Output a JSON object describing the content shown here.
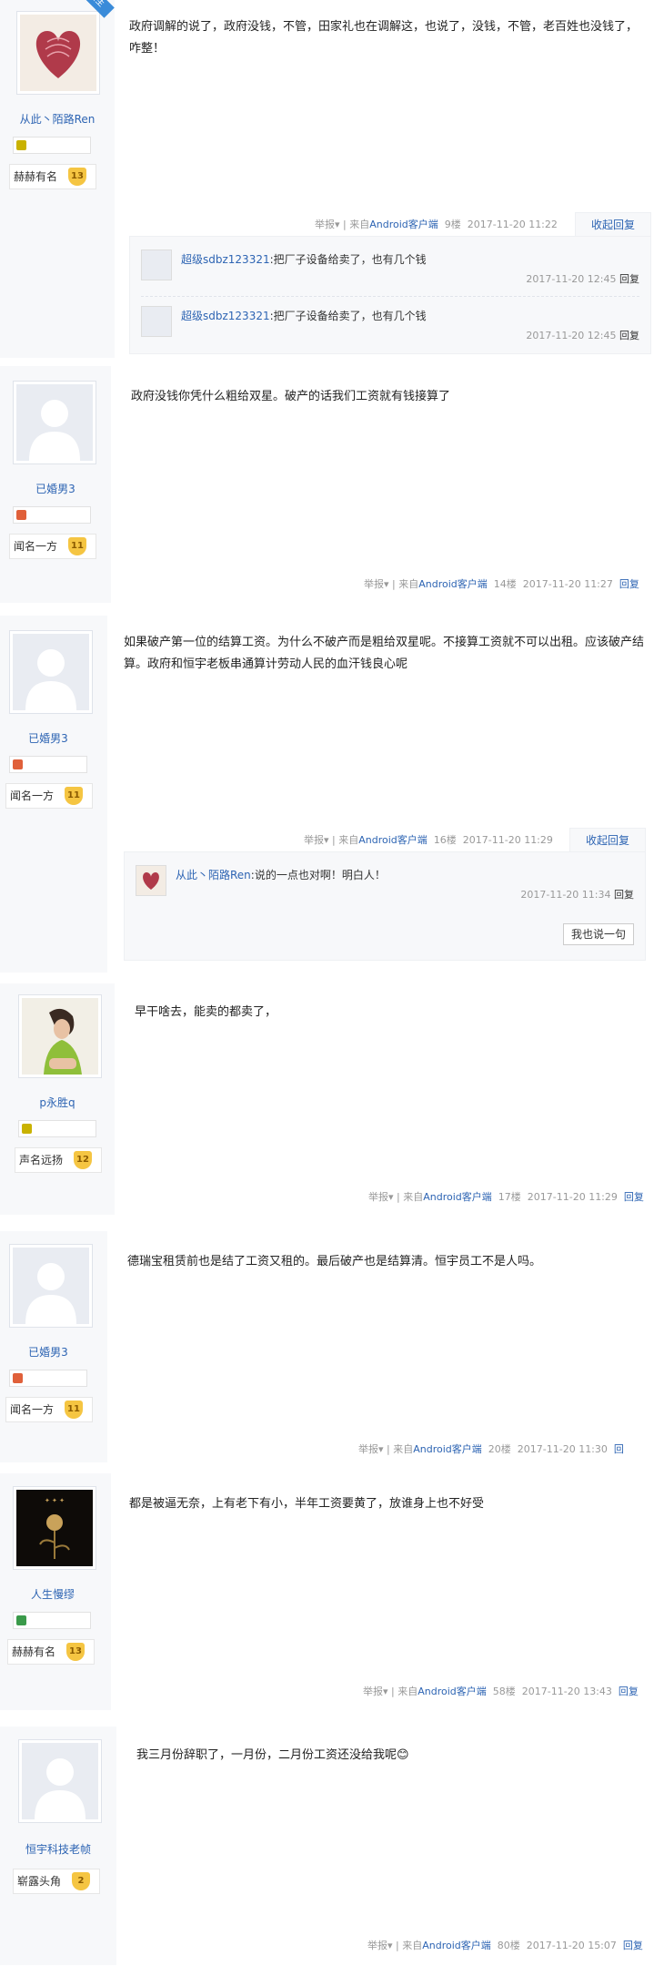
{
  "posts": [
    {
      "badge": "楼主",
      "username": "从此丶陌路Ren",
      "level_title": "赫赫有名",
      "level": "13",
      "content": "政府调解的说了，政府没钱，不管，田家礼也在调解这，也说了，没钱，不管，老百姓也没钱了，咋整！",
      "report": "举报",
      "sep": "| 来自",
      "source": "Android客户端",
      "floor": "9楼",
      "time": "2017-11-20 11:22",
      "collapse_label": "收起回复",
      "replies": [
        {
          "who": "超级sdbz123321",
          "text": ":把厂子设备给卖了，也有几个钱",
          "time": "2017-11-20 12:45",
          "reply": "回复"
        },
        {
          "who": "超级sdbz123321",
          "text": ":把厂子设备给卖了，也有几个钱",
          "time": "2017-11-20 12:45",
          "reply": "回复"
        }
      ]
    },
    {
      "username": "已婚男3",
      "level_title": "闻名一方",
      "level": "11",
      "content": "政府没钱你凭什么粗给双星。破产的话我们工资就有钱接算了",
      "report": "举报",
      "sep": "| 来自",
      "source": "Android客户端",
      "floor": "14楼",
      "time": "2017-11-20 11:27",
      "reply": "回复"
    },
    {
      "username": "已婚男3",
      "level_title": "闻名一方",
      "level": "11",
      "content": "如果破产第一位的结算工资。为什么不破产而是粗给双星呢。不接算工资就不可以出租。应该破产结算。政府和恒宇老板串通算计劳动人民的血汗钱良心呢",
      "report": "举报",
      "sep": "| 来自",
      "source": "Android客户端",
      "floor": "16楼",
      "time": "2017-11-20 11:29",
      "collapse_label": "收起回复",
      "replies": [
        {
          "who": "从此丶陌路Ren",
          "text": ":说的一点也对啊！明白人！",
          "time": "2017-11-20 11:34",
          "reply": "回复"
        }
      ],
      "say_label": "我也说一句"
    },
    {
      "username": "p永胜q",
      "level_title": "声名远扬",
      "level": "12",
      "content": "早干啥去，能卖的都卖了，",
      "report": "举报",
      "sep": "| 来自",
      "source": "Android客户端",
      "floor": "17楼",
      "time": "2017-11-20 11:29",
      "reply": "回复"
    },
    {
      "username": "已婚男3",
      "level_title": "闻名一方",
      "level": "11",
      "content": "德瑞宝租赁前也是结了工资又租的。最后破产也是结算清。恒宇员工不是人吗。",
      "report": "举报",
      "sep": "| 来自",
      "source": "Android客户端",
      "floor": "20楼",
      "time": "2017-11-20 11:30",
      "reply": "回"
    },
    {
      "username": "人生慢缪",
      "level_title": "赫赫有名",
      "level": "13",
      "content": "都是被逼无奈，上有老下有小，半年工资要黄了，放谁身上也不好受",
      "report": "举报",
      "sep": "| 来自",
      "source": "Android客户端",
      "floor": "58楼",
      "time": "2017-11-20 13:43",
      "reply": "回复"
    },
    {
      "username": "恒宇科技老帧",
      "level_title": "崭露头角",
      "level": "2",
      "content": "我三月份辞职了，一月份，二月份工资还没给我呢",
      "emoji": "😊",
      "report": "举报",
      "sep": "| 来自",
      "source": "Android客户端",
      "floor": "80楼",
      "time": "2017-11-20 15:07",
      "reply": "回复"
    }
  ],
  "colors": {
    "link": "#2d64b3",
    "meta": "#999999",
    "sidebar": "#f7f8fa",
    "level_badge": "#f5c542"
  }
}
